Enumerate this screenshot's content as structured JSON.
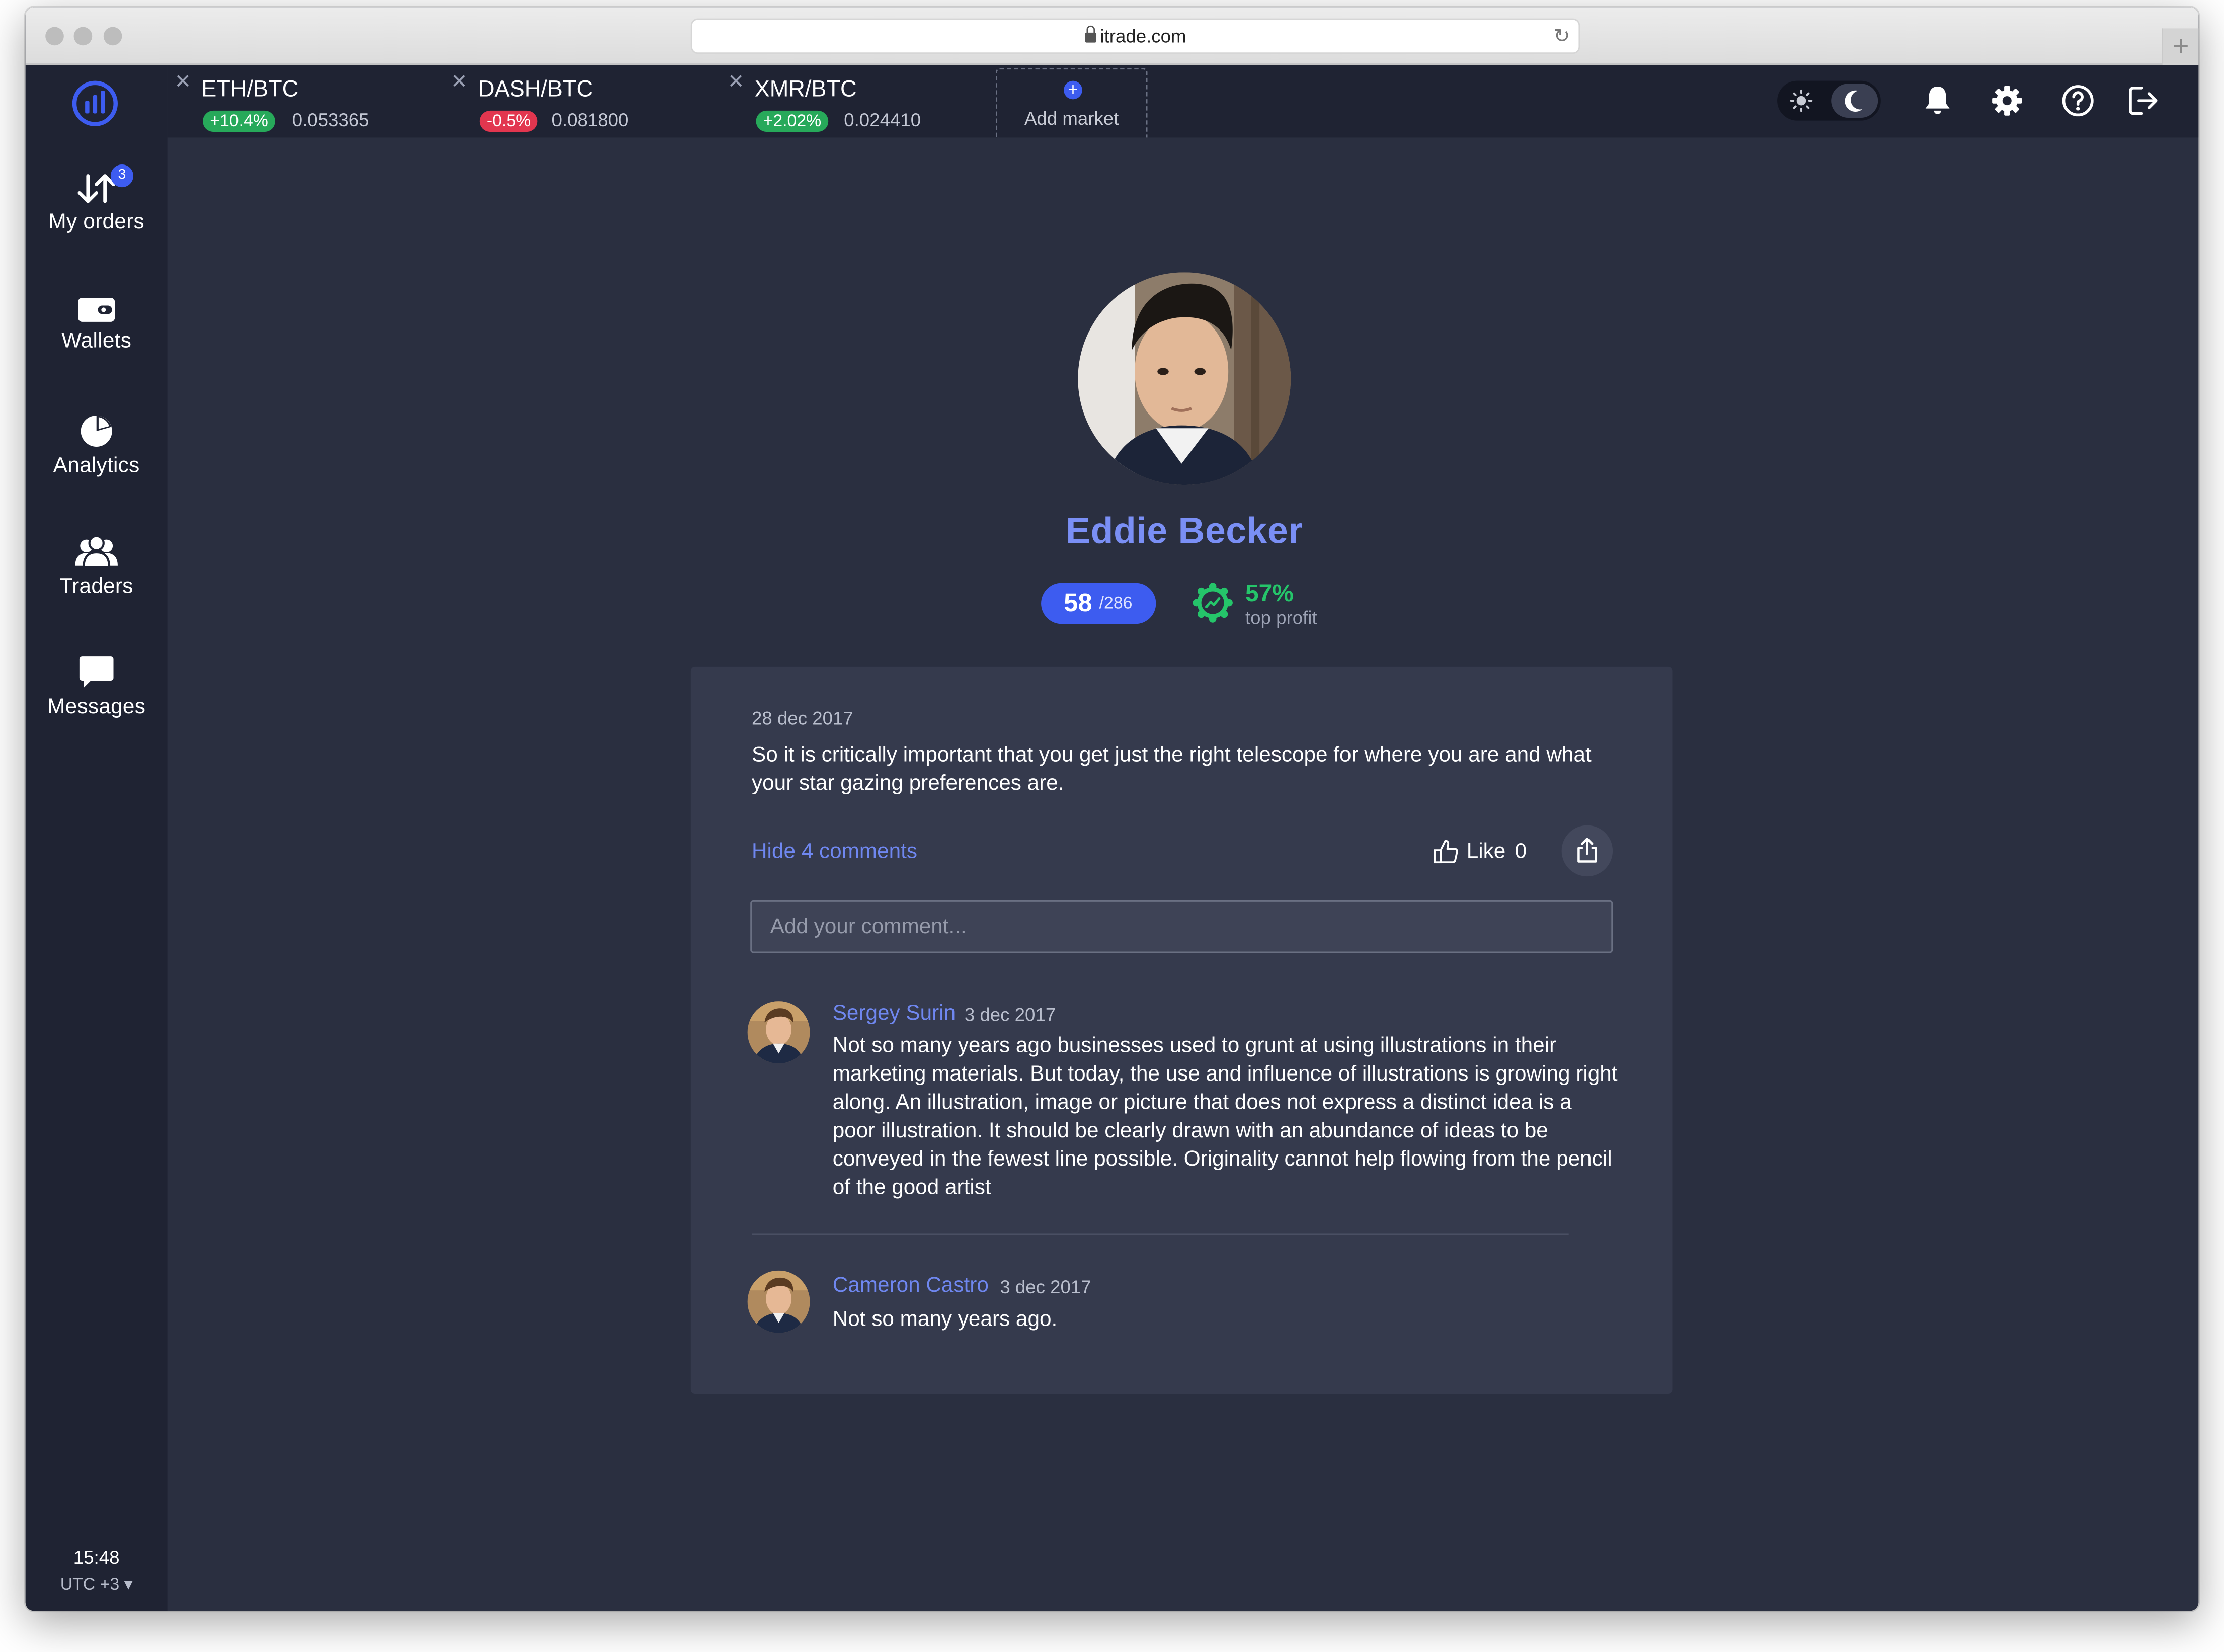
{
  "browser": {
    "url": "itrade.com"
  },
  "sidebar": {
    "items": [
      {
        "label": "My orders",
        "badge": "3",
        "icon": "orders-arrows-icon"
      },
      {
        "label": "Wallets",
        "icon": "wallet-icon"
      },
      {
        "label": "Analytics",
        "icon": "pie-chart-icon"
      },
      {
        "label": "Traders",
        "icon": "users-icon"
      },
      {
        "label": "Messages",
        "icon": "chat-bubble-icon"
      }
    ],
    "time": "15:48",
    "timezone": "UTC +3 ▾"
  },
  "markets": [
    {
      "pair": "ETH/BTC",
      "change": "+10.4%",
      "price": "0.053365",
      "change_color": "#27a95a"
    },
    {
      "pair": "DASH/BTC",
      "change": "-0.5%",
      "price": "0.081800",
      "change_color": "#e2364f"
    },
    {
      "pair": "XMR/BTC",
      "change": "+2.02%",
      "price": "0.024410",
      "change_color": "#27a95a"
    }
  ],
  "add_market": {
    "label": "Add market"
  },
  "profile": {
    "name": "Eddie Becker",
    "rank": "58",
    "rank_total": "/286",
    "profit_percent": "57%",
    "profit_label": "top profit"
  },
  "post": {
    "date": "28 dec 2017",
    "text": "So it is critically important that you get just the right telescope for where you are and what your star gazing preferences are.",
    "hide_comments_label": "Hide 4 comments",
    "like_label": "Like",
    "like_count": "0",
    "comment_placeholder": "Add your comment..."
  },
  "comments": [
    {
      "author": "Sergey Surin",
      "date": "3 dec 2017",
      "text": "Not so many years ago businesses used to grunt at using illustrations in their marketing materials. But today, the use and influence of illustrations is growing right along. An illustration, image or picture that does not express a distinct idea is a poor illustration. It should be clearly drawn with an abundance of ideas to be conveyed in the fewest line possible. Originality cannot help flowing from the pencil of the good artist"
    },
    {
      "author": "Cameron Castro",
      "date": "3 dec 2017",
      "text": "Not so many years ago."
    }
  ],
  "colors": {
    "accent": "#3d5cf0",
    "link": "#6f87f0",
    "sidebar_bg": "#1f2333",
    "main_bg": "#2a2f40",
    "card_bg": "#353a4d",
    "profit_green": "#25c56a"
  }
}
